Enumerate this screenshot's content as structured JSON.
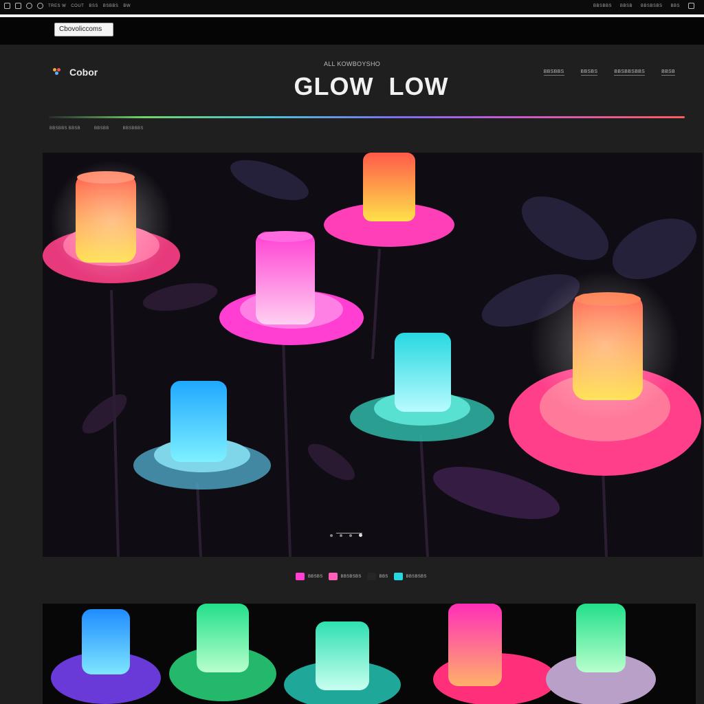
{
  "browser": {
    "menu_items": [
      "TRES W",
      "COUT",
      "BSS",
      "BSBBS",
      "BW"
    ],
    "right_items": [
      "BBSBBS",
      "BBSB",
      "BBSBSBS",
      "BBS"
    ],
    "address": "Cbovoliccoms"
  },
  "header": {
    "logo_text": "Cobor",
    "eyebrow": "ALL KOWBOYSHO",
    "title": "GLOW  LOW",
    "nav": [
      "BBSBBS",
      "BBSBS",
      "BBSBBSBBS",
      "BBSB"
    ],
    "subnav": [
      "BBSBBS BBSB",
      "BBSBB",
      "BBSBBBS"
    ]
  },
  "swatches": [
    {
      "label": "BBSBS",
      "color": "#ff3fd2"
    },
    {
      "label": "BBSBSBS",
      "color": "#ff5fb8"
    },
    {
      "label": "BBS",
      "color": "#262626"
    },
    {
      "label": "BBSBSBS",
      "color": "#27d8e0"
    }
  ],
  "colors": {
    "page_bg": "#1f1f1f",
    "accent_pink": "#ff3fd2",
    "accent_cyan": "#27d8e0",
    "accent_orange": "#ff8a3d"
  }
}
